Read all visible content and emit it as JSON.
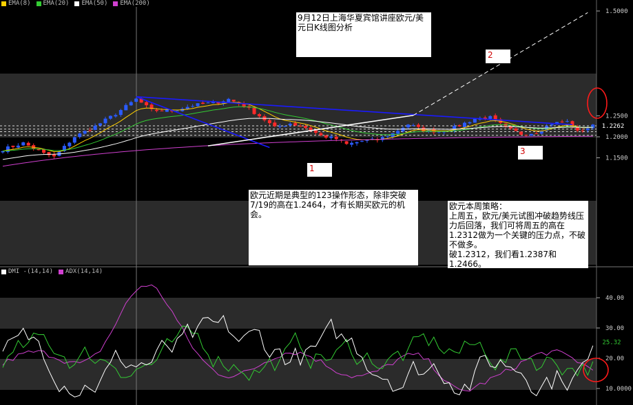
{
  "chart_data": [
    {
      "type": "candlestick",
      "instrument": "EUR/USD",
      "period": "daily",
      "ylim": [
        1.13,
        1.5
      ],
      "y_ticks": [
        "1.5000",
        "1.2500",
        "1.2000",
        "1.1500"
      ],
      "last_price": "1.2262",
      "legend": [
        {
          "name": "EMA(8)",
          "color": "#ffd000"
        },
        {
          "name": "EMA(20)",
          "color": "#33cc33"
        },
        {
          "name": "EMA(50)",
          "color": "#ffffff"
        },
        {
          "name": "EMA(200)",
          "color": "#d040d0"
        }
      ],
      "candle_colors": {
        "up": "#2a5bff",
        "down": "#ff2a2a"
      },
      "horizontal_levels": [
        1.2262,
        1.2185,
        1.2123,
        1.2037
      ],
      "trendlines": [
        {
          "from": [
            26,
            1.2956
          ],
          "to": [
            52,
            1.1745
          ],
          "color": "#1a1aff"
        },
        {
          "from": [
            26,
            1.2956
          ],
          "to": [
            111,
            1.229
          ],
          "color": "#1a1aff"
        },
        {
          "from": [
            40,
            1.1785
          ],
          "to": [
            80,
            1.2512
          ],
          "color": "#ffffff"
        },
        {
          "from": [
            80,
            1.2512
          ],
          "to": [
            114,
            1.4962
          ],
          "color": "#ffffff",
          "dashed": true
        }
      ],
      "point_labels": [
        "1",
        "2",
        "3"
      ],
      "annotations": {
        "title": "9月12日上海华夏宾馆讲座欧元/美元日K线图分析",
        "pattern": "欧元近期是典型的123操作形态，除非突破7/19的高在1.2464，才有长期买欧元的机会。",
        "strategy": "欧元本周策略：\n上周五，欧元/美元试图冲破趋势线压力后回落，我们可将周五的高在1.2312做为一个关键的压力点，不破不做多。\n破1.2312，我们看1.2387和1.2466。"
      }
    },
    {
      "type": "line",
      "ylim": [
        6,
        46
      ],
      "y_ticks": [
        "40.00",
        "30.00",
        "20.00",
        "10.0000"
      ],
      "last_value": "25.32",
      "legend": [
        {
          "name": "DMI -(14,14)",
          "color": "#ffffff"
        },
        {
          "name": "ADX(14,14)",
          "color": "#d040d0"
        }
      ],
      "series": [
        {
          "name": "ADX(14,14)",
          "color": "#d040d0"
        },
        {
          "color": "#33cc33"
        },
        {
          "name": "DMI -(14,14)",
          "color": "#ffffff"
        }
      ]
    }
  ]
}
